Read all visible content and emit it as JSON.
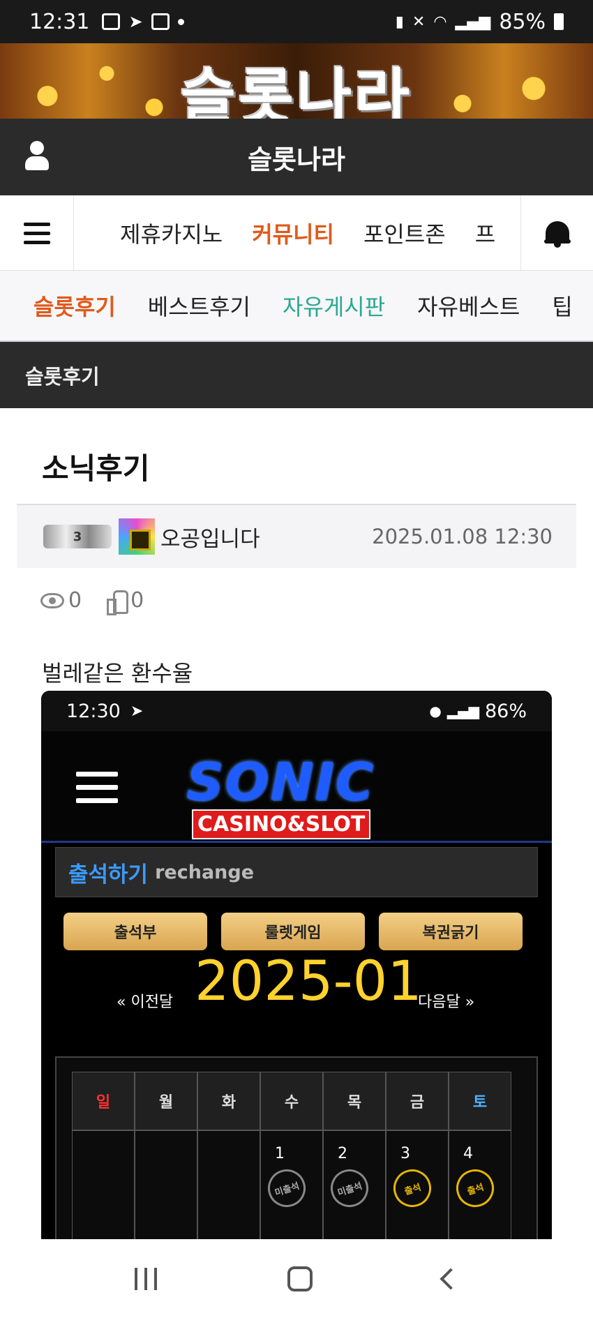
{
  "status_bar": {
    "time": "12:31",
    "battery": "85%"
  },
  "banner": {
    "logo_text": "슬롯나라"
  },
  "header": {
    "site_title": "슬롯나라"
  },
  "main_nav": {
    "items": [
      "제휴카지노",
      "커뮤니티",
      "포인트존",
      "프"
    ],
    "active": "커뮤니티"
  },
  "sub_nav": {
    "items": [
      "슬롯후기",
      "베스트후기",
      "자유게시판",
      "자유베스트",
      "팁"
    ],
    "active": "슬롯후기"
  },
  "board": {
    "name": "슬롯후기"
  },
  "post": {
    "title": "소닉후기",
    "level_badge": "3",
    "author": "오공입니다",
    "date": "2025.01.08 12:30",
    "views": "0",
    "likes": "0",
    "body": "벌레같은 환수율"
  },
  "embedded": {
    "status_time": "12:30",
    "status_battery": "86%",
    "logo_main": "SONIC",
    "logo_sub": "CASINO&SLOT",
    "attend_title": "출석하기",
    "attend_sub": "rechange",
    "buttons": [
      "출석부",
      "룰렛게임",
      "복권긁기"
    ],
    "prev_month": "« 이전달",
    "year_month": "2025-01",
    "next_month": "다음달 »",
    "weekdays": [
      "일",
      "월",
      "화",
      "수",
      "목",
      "금",
      "토"
    ],
    "days": [
      {
        "num": "",
        "stamp": ""
      },
      {
        "num": "",
        "stamp": ""
      },
      {
        "num": "",
        "stamp": ""
      },
      {
        "num": "1",
        "stamp": "미출석"
      },
      {
        "num": "2",
        "stamp": "미출석"
      },
      {
        "num": "3",
        "stamp": "출석"
      },
      {
        "num": "4",
        "stamp": "출석"
      }
    ]
  },
  "colors": {
    "accent": "#e05a1c",
    "teal": "#2aa893",
    "dark": "#2b2b2b"
  }
}
